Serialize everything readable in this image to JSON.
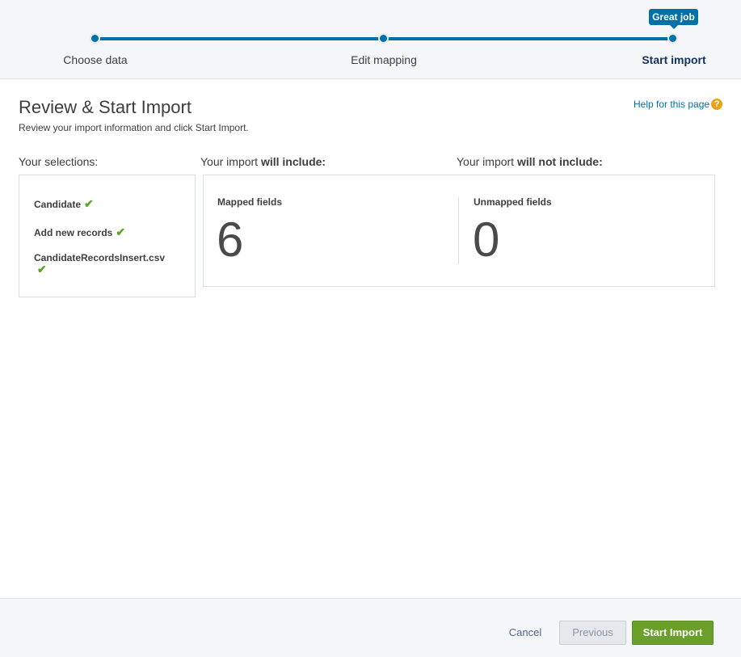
{
  "wizard": {
    "steps": [
      {
        "label": "Choose data",
        "state": "complete"
      },
      {
        "label": "Edit mapping",
        "state": "complete"
      },
      {
        "label": "Start import",
        "state": "active"
      }
    ],
    "tooltip": "Great job",
    "accent_color": "#0070a8"
  },
  "page": {
    "title": "Review & Start Import",
    "subtitle": "Review your import information and click Start Import.",
    "help_link": "Help for this page",
    "help_icon": "question-icon"
  },
  "selections": {
    "label": "Your selections:",
    "items": [
      {
        "text": "Candidate",
        "icon": "check-icon"
      },
      {
        "text": "Add new records",
        "icon": "check-icon"
      },
      {
        "text": "CandidateRecordsInsert.csv",
        "icon": "check-icon"
      }
    ],
    "check_color": "#5ba31e"
  },
  "include": {
    "label_prefix": "Your import ",
    "label_bold": "will include:",
    "title": "Mapped fields",
    "count": "6"
  },
  "exclude": {
    "label_prefix": "Your import ",
    "label_bold": "will not include:",
    "title": "Unmapped fields",
    "count": "0"
  },
  "footer": {
    "cancel": "Cancel",
    "previous": "Previous",
    "start": "Start Import",
    "start_color": "#6aa02a"
  }
}
